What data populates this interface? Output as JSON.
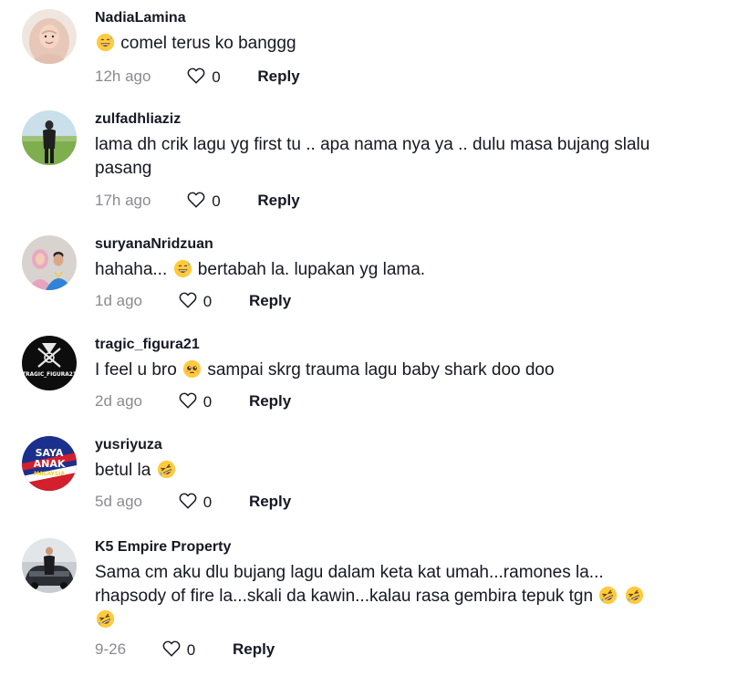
{
  "comments": [
    {
      "username": "NadiaLamina",
      "text": [
        {
          "emoji": "grinning-sweat"
        },
        {
          "t": " comel terus ko banggg"
        }
      ],
      "time": "12h ago",
      "likes": "0",
      "reply_label": "Reply",
      "avatar": "hijab-woman-photo"
    },
    {
      "username": "zulfadhliaziz",
      "text": [
        {
          "t": "lama dh crik lagu yg first tu .. apa nama nya ya .. dulu masa bujang slalu pasang"
        }
      ],
      "time": "17h ago",
      "likes": "0",
      "reply_label": "Reply",
      "avatar": "man-in-field-photo"
    },
    {
      "username": "suryanaNridzuan",
      "text": [
        {
          "t": "hahaha... "
        },
        {
          "emoji": "grinning-sweat"
        },
        {
          "t": " bertabah la. lupakan yg lama."
        }
      ],
      "time": "1d ago",
      "likes": "0",
      "reply_label": "Reply",
      "avatar": "couple-photo"
    },
    {
      "username": "tragic_figura21",
      "text": [
        {
          "t": "I feel u bro "
        },
        {
          "emoji": "pleading-face"
        },
        {
          "t": " sampai skrg trauma lagu baby shark doo doo"
        }
      ],
      "time": "2d ago",
      "likes": "0",
      "reply_label": "Reply",
      "avatar": "tragic-figura-logo",
      "avatar_text": "TRAGIC_FIGURA21"
    },
    {
      "username": "yusriyuza",
      "text": [
        {
          "t": "betul la "
        },
        {
          "emoji": "rofl"
        }
      ],
      "time": "5d ago",
      "likes": "0",
      "reply_label": "Reply",
      "avatar": "saya-anak-malaysia-logo",
      "avatar_text": [
        "SAYA",
        "ANAK",
        "MALAYSIA"
      ]
    },
    {
      "username": "K5 Empire Property",
      "text": [
        {
          "t": "Sama cm aku dlu bujang lagu dalam keta kat umah...ramones la... rhapsody of fire la...skali da kawin...kalau rasa gembira tepuk tgn "
        },
        {
          "emoji": "rofl"
        },
        {
          "t": " "
        },
        {
          "emoji": "rofl"
        },
        {
          "emoji": "rofl"
        }
      ],
      "time": "9-26",
      "likes": "0",
      "reply_label": "Reply",
      "avatar": "man-with-car-photo"
    }
  ],
  "colors": {
    "text": "#161823",
    "muted": "#8a8b91",
    "background": "#ffffff"
  }
}
